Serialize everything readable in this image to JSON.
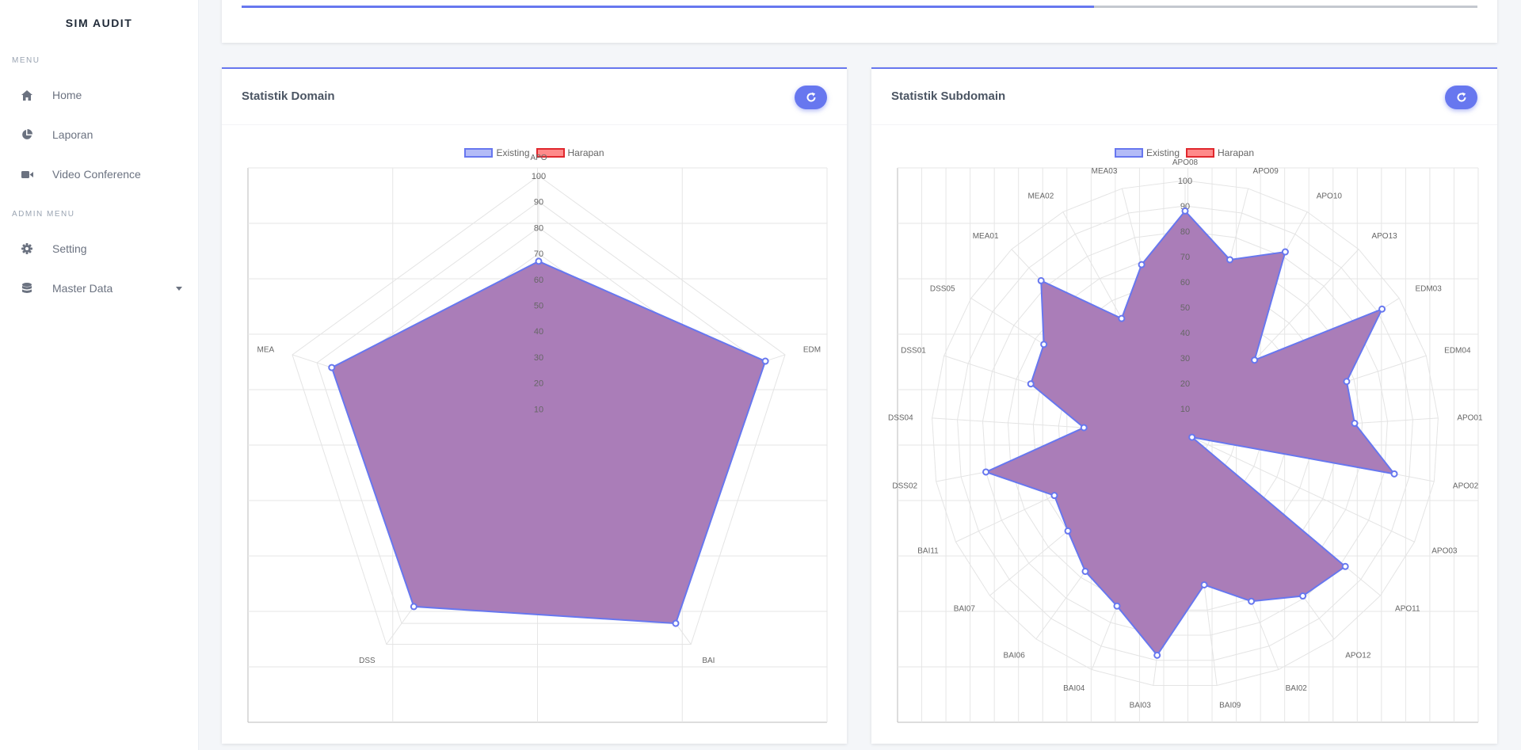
{
  "sidebar": {
    "brand": "SIM AUDIT",
    "menu_header": "MENU",
    "admin_header": "ADMIN MENU",
    "items": [
      {
        "label": "Home",
        "icon": "home-icon"
      },
      {
        "label": "Laporan",
        "icon": "pie-chart-icon"
      },
      {
        "label": "Video Conference",
        "icon": "video-camera-icon"
      },
      {
        "label": "Setting",
        "icon": "gear-icon"
      },
      {
        "label": "Master Data",
        "icon": "database-icon"
      }
    ]
  },
  "progress": {
    "value_percent": 69
  },
  "colors": {
    "accent": "#6777ef",
    "existing_fill": "#a779b6",
    "existing_line": "#6777ef",
    "harapan_fill": "#ff8a8a",
    "harapan_line": "#e0282e"
  },
  "domain_card": {
    "title": "Statistik Domain",
    "refresh_icon": "refresh-icon"
  },
  "subdomain_card": {
    "title": "Statistik Subdomain",
    "refresh_icon": "refresh-icon"
  },
  "legend": {
    "existing": "Existing",
    "harapan": "Harapan"
  },
  "chart_data": [
    {
      "type": "radar",
      "categories": [
        "APO",
        "EDM",
        "BAI",
        "DSS",
        "MEA"
      ],
      "r_ticks": [
        10,
        20,
        30,
        40,
        50,
        60,
        70,
        80,
        90,
        100
      ],
      "r_range": [
        0,
        100
      ],
      "series": [
        {
          "name": "Existing",
          "values": [
            67,
            92,
            90,
            82,
            84
          ]
        },
        {
          "name": "Harapan",
          "values": []
        }
      ],
      "legend_position": "top",
      "grid": true
    },
    {
      "type": "radar",
      "categories": [
        "APO08",
        "APO09",
        "APO10",
        "APO13",
        "EDM03",
        "EDM04",
        "APO01",
        "APO02",
        "APO03",
        "APO11",
        "APO12",
        "BAI02",
        "BAI09",
        "BAI03",
        "BAI04",
        "BAI06",
        "BAI07",
        "BAI11",
        "DSS02",
        "DSS04",
        "DSS01",
        "DSS05",
        "MEA01",
        "MEA02",
        "MEA03"
      ],
      "r_ticks": [
        10,
        20,
        30,
        40,
        50,
        60,
        70,
        80,
        90,
        100
      ],
      "r_range": [
        0,
        100
      ],
      "series": [
        {
          "name": "Existing",
          "values": [
            88,
            71,
            82,
            40,
            92,
            67,
            67,
            84,
            3,
            82,
            79,
            71,
            60,
            88,
            73,
            67,
            60,
            57,
            80,
            40,
            64,
            66,
            83,
            52,
            69
          ]
        },
        {
          "name": "Harapan",
          "values": []
        }
      ],
      "legend_position": "top",
      "grid": true
    }
  ]
}
